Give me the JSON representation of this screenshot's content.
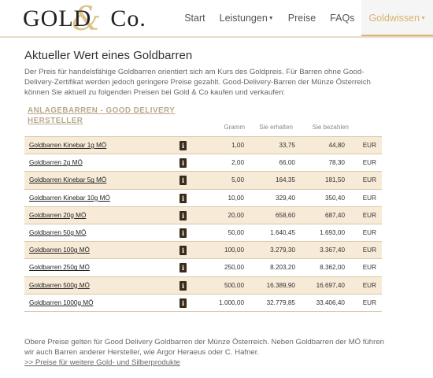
{
  "brand": {
    "left": "GOLD",
    "amp": "&",
    "right": "Co."
  },
  "nav": [
    {
      "label": "Start",
      "caret": false,
      "active": false
    },
    {
      "label": "Leistungen",
      "caret": true,
      "active": false
    },
    {
      "label": "Preise",
      "caret": false,
      "active": false
    },
    {
      "label": "FAQs",
      "caret": false,
      "active": false
    },
    {
      "label": "Goldwissen",
      "caret": true,
      "active": true
    }
  ],
  "page": {
    "title": "Aktueller Wert eines Goldbarren",
    "intro": "Der Preis für handelsfähige Goldbarren orientiert sich am Kurs des Goldpreis. Für Barren ohne Good-Delivery-Zertifikat werden jedoch geringere Preise gezahlt. Good-Delivery-Barren der Münze Österreich können Sie aktuell zu folgenden Preisen bei Gold & Co kaufen und verkaufen:"
  },
  "table": {
    "section_title_1": "ANLAGEBARREN - GOOD DELIVERY",
    "section_title_2": "HERSTELLER",
    "col_gramm": "Gramm",
    "col_sie_erhalten": "Sie erhalten",
    "col_sie_bezahlen": "Sie bezahlen",
    "info_glyph": "i",
    "rows": [
      {
        "name": "Goldbarren Kinebar 1g MÖ",
        "gramm": "1,00",
        "erhalten": "33,75",
        "bezahlen": "44,80",
        "currency": "EUR"
      },
      {
        "name": "Goldbarren 2g MÖ",
        "gramm": "2,00",
        "erhalten": "66,00",
        "bezahlen": "78,30",
        "currency": "EUR"
      },
      {
        "name": "Goldbarren Kinebar 5g MÖ",
        "gramm": "5,00",
        "erhalten": "164,35",
        "bezahlen": "181,50",
        "currency": "EUR"
      },
      {
        "name": "Goldbarren Kinebar 10g MÖ",
        "gramm": "10,00",
        "erhalten": "329,40",
        "bezahlen": "350,40",
        "currency": "EUR"
      },
      {
        "name": "Goldbarren 20g MÖ",
        "gramm": "20,00",
        "erhalten": "658,60",
        "bezahlen": "687,40",
        "currency": "EUR"
      },
      {
        "name": "Goldbarren 50g MÖ",
        "gramm": "50,00",
        "erhalten": "1.640,45",
        "bezahlen": "1.693,00",
        "currency": "EUR"
      },
      {
        "name": "Goldbarren 100g MÖ",
        "gramm": "100,00",
        "erhalten": "3.279,30",
        "bezahlen": "3.367,40",
        "currency": "EUR"
      },
      {
        "name": "Goldbarren 250g MÖ",
        "gramm": "250,00",
        "erhalten": "8.203,20",
        "bezahlen": "8.362,00",
        "currency": "EUR"
      },
      {
        "name": "Goldbarren 500g MÖ",
        "gramm": "500,00",
        "erhalten": "16.389,90",
        "bezahlen": "16.697,40",
        "currency": "EUR"
      },
      {
        "name": "Goldbarren 1000g MÖ",
        "gramm": "1.000,00",
        "erhalten": "32.779,85",
        "bezahlen": "33.406,40",
        "currency": "EUR"
      }
    ]
  },
  "footer": {
    "text": "Obere Preise gelten für Good Delivery Goldbarren der Münze Österreich. Neben Goldbarren der MÖ führen wir auch Barren anderer Hersteller, wie Argor Heraeus oder C. Hafner.",
    "link": ">> Preise für weitere Gold- und Silberprodukte"
  },
  "colors": {
    "accent": "#d6b470",
    "row_alt": "#f7ebd8",
    "info_icon_bg": "#3a2b1b"
  }
}
